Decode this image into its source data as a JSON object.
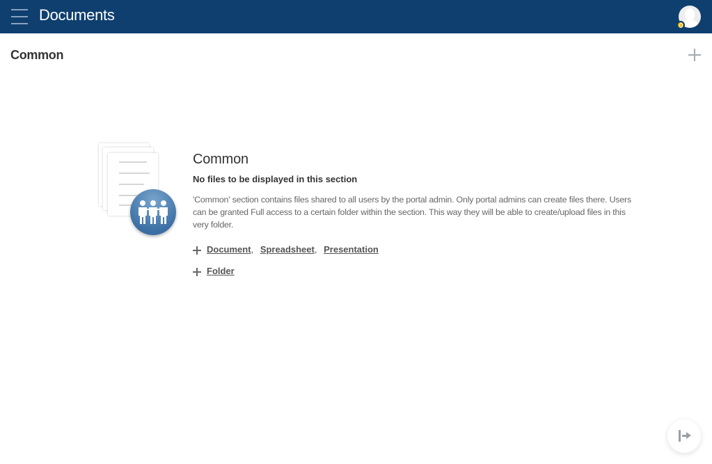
{
  "header": {
    "title": "Documents",
    "menu_icon": "hamburger-icon",
    "avatar_icon": "user-avatar-icon",
    "badge_icon": "coin-badge-icon",
    "background_color": "#0f3f6f"
  },
  "section": {
    "title": "Common",
    "add_icon": "plus-icon"
  },
  "empty_state": {
    "illustration_icon": "shared-documents-people-icon",
    "title": "Common",
    "subtitle": "No files to be displayed in this section",
    "description": "'Common' section contains files shared to all users by the portal admin. Only portal admins can create files there. Users can be granted Full access to a certain folder within the section. This way they will be able to create/upload files in this very folder.",
    "create_links": [
      "Document",
      "Spreadsheet",
      "Presentation"
    ],
    "separator": ",",
    "folder_link": "Folder"
  },
  "fab": {
    "icon": "arrow-right-to-bar-icon"
  }
}
